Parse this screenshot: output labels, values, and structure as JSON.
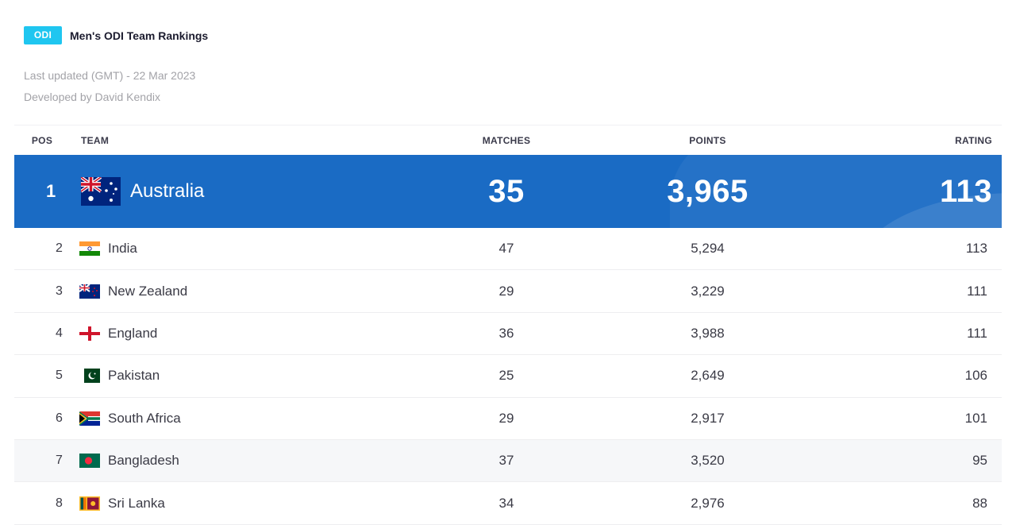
{
  "header": {
    "badge": "ODI",
    "title": "Men's ODI Team Rankings"
  },
  "meta": {
    "last_updated": "Last updated (GMT) - 22 Mar 2023",
    "developer": "Developed by David Kendix"
  },
  "table": {
    "columns": {
      "pos": "POS",
      "team": "TEAM",
      "matches": "MATCHES",
      "points": "POINTS",
      "rating": "RATING"
    },
    "top": {
      "pos": "1",
      "team": "Australia",
      "flag": "australia-flag-icon",
      "matches": "35",
      "points": "3,965",
      "rating": "113"
    },
    "rows": [
      {
        "pos": "2",
        "team": "India",
        "flag": "india-flag-icon",
        "matches": "47",
        "points": "5,294",
        "rating": "113"
      },
      {
        "pos": "3",
        "team": "New Zealand",
        "flag": "new-zealand-flag-icon",
        "matches": "29",
        "points": "3,229",
        "rating": "111"
      },
      {
        "pos": "4",
        "team": "England",
        "flag": "england-flag-icon",
        "matches": "36",
        "points": "3,988",
        "rating": "111"
      },
      {
        "pos": "5",
        "team": "Pakistan",
        "flag": "pakistan-flag-icon",
        "matches": "25",
        "points": "2,649",
        "rating": "106"
      },
      {
        "pos": "6",
        "team": "South Africa",
        "flag": "south-africa-flag-icon",
        "matches": "29",
        "points": "2,917",
        "rating": "101"
      },
      {
        "pos": "7",
        "team": "Bangladesh",
        "flag": "bangladesh-flag-icon",
        "matches": "37",
        "points": "3,520",
        "rating": "95"
      },
      {
        "pos": "8",
        "team": "Sri Lanka",
        "flag": "sri-lanka-flag-icon",
        "matches": "34",
        "points": "2,976",
        "rating": "88"
      }
    ]
  },
  "colors": {
    "badge": "#1fc6f0",
    "highlight_row": "#1a6bc4",
    "muted_text": "#a3a3a8"
  }
}
